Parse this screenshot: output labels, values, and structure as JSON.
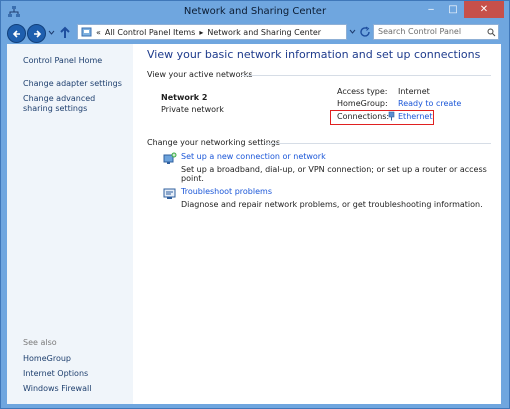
{
  "window": {
    "title": "Network and Sharing Center",
    "controls": {
      "minimize": "‒",
      "maximize": "□",
      "close": "✕"
    }
  },
  "address": {
    "chevron": "«",
    "segments": [
      "All Control Panel Items",
      "Network and Sharing Center"
    ],
    "separator": "▸"
  },
  "search": {
    "placeholder": "Search Control Panel"
  },
  "sidebar": {
    "home": "Control Panel Home",
    "links": [
      "Change adapter settings",
      "Change advanced sharing settings"
    ],
    "see_also_title": "See also",
    "see_also": [
      "HomeGroup",
      "Internet Options",
      "Windows Firewall"
    ]
  },
  "main": {
    "heading": "View your basic network information and set up connections",
    "active_title": "View your active networks",
    "network_name": "Network  2",
    "network_type": "Private network",
    "access_label": "Access type:",
    "access_value": "Internet",
    "homegroup_label": "HomeGroup:",
    "homegroup_value": "Ready to create",
    "connections_label": "Connections:",
    "connections_value": "Ethernet",
    "change_title": "Change your networking settings",
    "tasks": [
      {
        "title": "Set up a new connection or network",
        "desc": "Set up a broadband, dial-up, or VPN connection; or set up a router or access point."
      },
      {
        "title": "Troubleshoot problems",
        "desc": "Diagnose and repair network problems, or get troubleshooting information."
      }
    ]
  },
  "colors": {
    "link": "#1a56d8",
    "heading": "#1e3b8c",
    "highlight": "#e02020",
    "titlebar": "#6fa6df"
  }
}
